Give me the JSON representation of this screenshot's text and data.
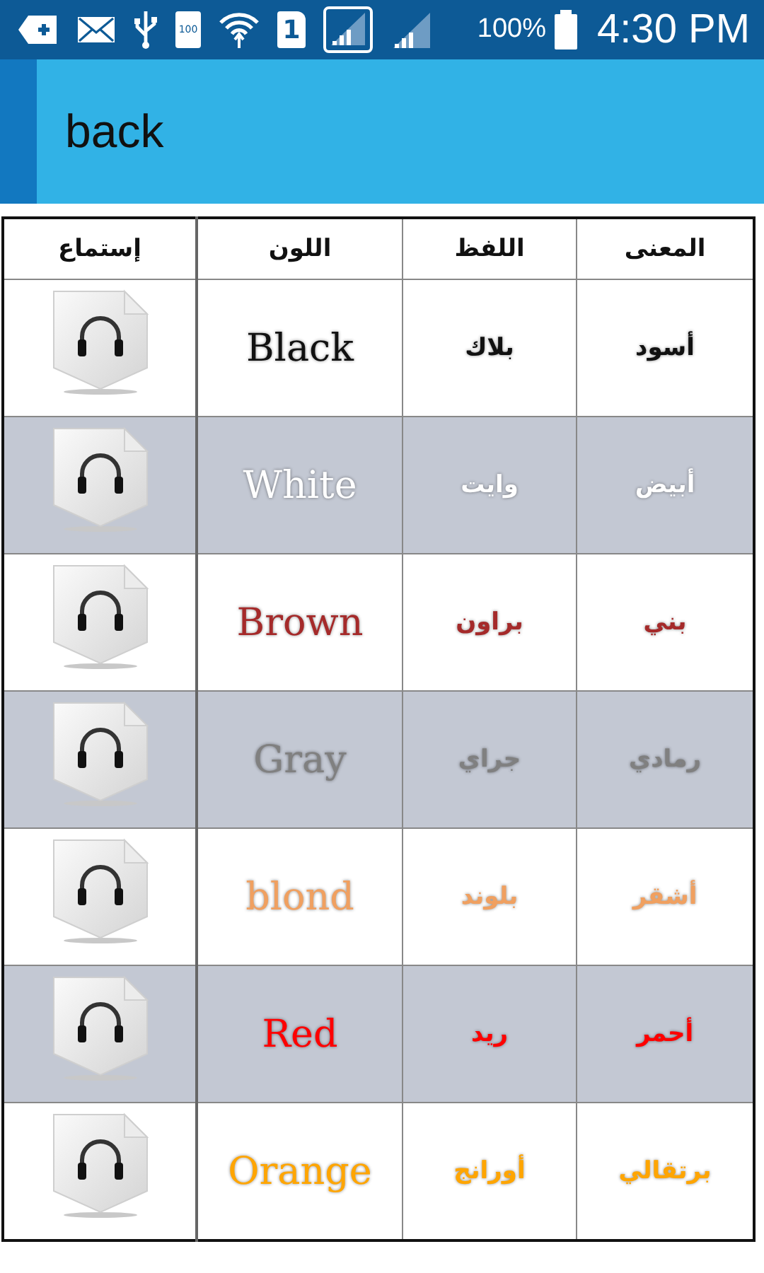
{
  "status_bar": {
    "sim_label": "1",
    "battery_icon_label": "100",
    "battery_percent": "100%",
    "time": "4:30 PM"
  },
  "app_bar": {
    "title": "back"
  },
  "table": {
    "columns": [
      "المعنى",
      "اللفظ",
      "اللون",
      "إستماع"
    ],
    "rows": [
      {
        "meaning": "أسود",
        "pronunciation": "بلاك",
        "color_name": "Black",
        "color": "#111111"
      },
      {
        "meaning": "أبيض",
        "pronunciation": "وايت",
        "color_name": "White",
        "color": "#ffffff"
      },
      {
        "meaning": "بني",
        "pronunciation": "براون",
        "color_name": "Brown",
        "color": "#a52a2a"
      },
      {
        "meaning": "رمادي",
        "pronunciation": "جراي",
        "color_name": "Gray",
        "color": "#808080"
      },
      {
        "meaning": "أشقر",
        "pronunciation": "بلوند",
        "color_name": "blond",
        "color": "#f0a060"
      },
      {
        "meaning": "أحمر",
        "pronunciation": "ريد",
        "color_name": "Red",
        "color": "#ff0000"
      },
      {
        "meaning": "برتقالي",
        "pronunciation": "أورانج",
        "color_name": "Orange",
        "color": "#ffa500"
      }
    ]
  }
}
